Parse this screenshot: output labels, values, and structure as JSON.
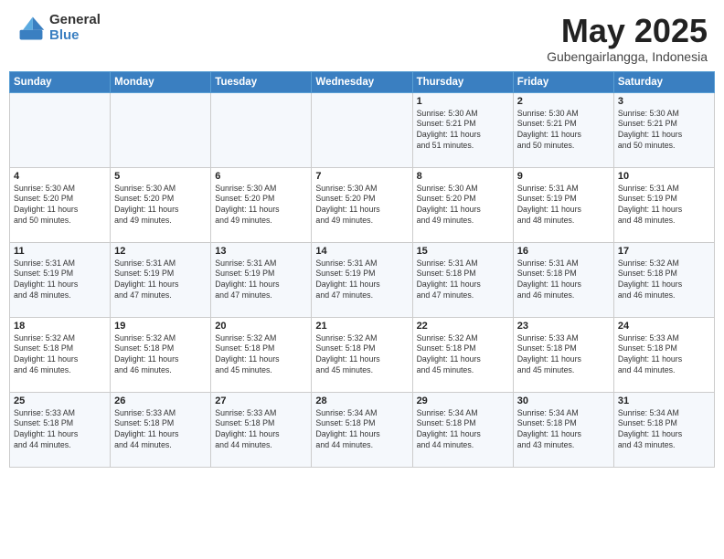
{
  "header": {
    "logo_general": "General",
    "logo_blue": "Blue",
    "month_title": "May 2025",
    "location": "Gubengairlangga, Indonesia"
  },
  "weekdays": [
    "Sunday",
    "Monday",
    "Tuesday",
    "Wednesday",
    "Thursday",
    "Friday",
    "Saturday"
  ],
  "weeks": [
    [
      {
        "day": "",
        "info": ""
      },
      {
        "day": "",
        "info": ""
      },
      {
        "day": "",
        "info": ""
      },
      {
        "day": "",
        "info": ""
      },
      {
        "day": "1",
        "info": "Sunrise: 5:30 AM\nSunset: 5:21 PM\nDaylight: 11 hours\nand 51 minutes."
      },
      {
        "day": "2",
        "info": "Sunrise: 5:30 AM\nSunset: 5:21 PM\nDaylight: 11 hours\nand 50 minutes."
      },
      {
        "day": "3",
        "info": "Sunrise: 5:30 AM\nSunset: 5:21 PM\nDaylight: 11 hours\nand 50 minutes."
      }
    ],
    [
      {
        "day": "4",
        "info": "Sunrise: 5:30 AM\nSunset: 5:20 PM\nDaylight: 11 hours\nand 50 minutes."
      },
      {
        "day": "5",
        "info": "Sunrise: 5:30 AM\nSunset: 5:20 PM\nDaylight: 11 hours\nand 49 minutes."
      },
      {
        "day": "6",
        "info": "Sunrise: 5:30 AM\nSunset: 5:20 PM\nDaylight: 11 hours\nand 49 minutes."
      },
      {
        "day": "7",
        "info": "Sunrise: 5:30 AM\nSunset: 5:20 PM\nDaylight: 11 hours\nand 49 minutes."
      },
      {
        "day": "8",
        "info": "Sunrise: 5:30 AM\nSunset: 5:20 PM\nDaylight: 11 hours\nand 49 minutes."
      },
      {
        "day": "9",
        "info": "Sunrise: 5:31 AM\nSunset: 5:19 PM\nDaylight: 11 hours\nand 48 minutes."
      },
      {
        "day": "10",
        "info": "Sunrise: 5:31 AM\nSunset: 5:19 PM\nDaylight: 11 hours\nand 48 minutes."
      }
    ],
    [
      {
        "day": "11",
        "info": "Sunrise: 5:31 AM\nSunset: 5:19 PM\nDaylight: 11 hours\nand 48 minutes."
      },
      {
        "day": "12",
        "info": "Sunrise: 5:31 AM\nSunset: 5:19 PM\nDaylight: 11 hours\nand 47 minutes."
      },
      {
        "day": "13",
        "info": "Sunrise: 5:31 AM\nSunset: 5:19 PM\nDaylight: 11 hours\nand 47 minutes."
      },
      {
        "day": "14",
        "info": "Sunrise: 5:31 AM\nSunset: 5:19 PM\nDaylight: 11 hours\nand 47 minutes."
      },
      {
        "day": "15",
        "info": "Sunrise: 5:31 AM\nSunset: 5:18 PM\nDaylight: 11 hours\nand 47 minutes."
      },
      {
        "day": "16",
        "info": "Sunrise: 5:31 AM\nSunset: 5:18 PM\nDaylight: 11 hours\nand 46 minutes."
      },
      {
        "day": "17",
        "info": "Sunrise: 5:32 AM\nSunset: 5:18 PM\nDaylight: 11 hours\nand 46 minutes."
      }
    ],
    [
      {
        "day": "18",
        "info": "Sunrise: 5:32 AM\nSunset: 5:18 PM\nDaylight: 11 hours\nand 46 minutes."
      },
      {
        "day": "19",
        "info": "Sunrise: 5:32 AM\nSunset: 5:18 PM\nDaylight: 11 hours\nand 46 minutes."
      },
      {
        "day": "20",
        "info": "Sunrise: 5:32 AM\nSunset: 5:18 PM\nDaylight: 11 hours\nand 45 minutes."
      },
      {
        "day": "21",
        "info": "Sunrise: 5:32 AM\nSunset: 5:18 PM\nDaylight: 11 hours\nand 45 minutes."
      },
      {
        "day": "22",
        "info": "Sunrise: 5:32 AM\nSunset: 5:18 PM\nDaylight: 11 hours\nand 45 minutes."
      },
      {
        "day": "23",
        "info": "Sunrise: 5:33 AM\nSunset: 5:18 PM\nDaylight: 11 hours\nand 45 minutes."
      },
      {
        "day": "24",
        "info": "Sunrise: 5:33 AM\nSunset: 5:18 PM\nDaylight: 11 hours\nand 44 minutes."
      }
    ],
    [
      {
        "day": "25",
        "info": "Sunrise: 5:33 AM\nSunset: 5:18 PM\nDaylight: 11 hours\nand 44 minutes."
      },
      {
        "day": "26",
        "info": "Sunrise: 5:33 AM\nSunset: 5:18 PM\nDaylight: 11 hours\nand 44 minutes."
      },
      {
        "day": "27",
        "info": "Sunrise: 5:33 AM\nSunset: 5:18 PM\nDaylight: 11 hours\nand 44 minutes."
      },
      {
        "day": "28",
        "info": "Sunrise: 5:34 AM\nSunset: 5:18 PM\nDaylight: 11 hours\nand 44 minutes."
      },
      {
        "day": "29",
        "info": "Sunrise: 5:34 AM\nSunset: 5:18 PM\nDaylight: 11 hours\nand 44 minutes."
      },
      {
        "day": "30",
        "info": "Sunrise: 5:34 AM\nSunset: 5:18 PM\nDaylight: 11 hours\nand 43 minutes."
      },
      {
        "day": "31",
        "info": "Sunrise: 5:34 AM\nSunset: 5:18 PM\nDaylight: 11 hours\nand 43 minutes."
      }
    ]
  ]
}
